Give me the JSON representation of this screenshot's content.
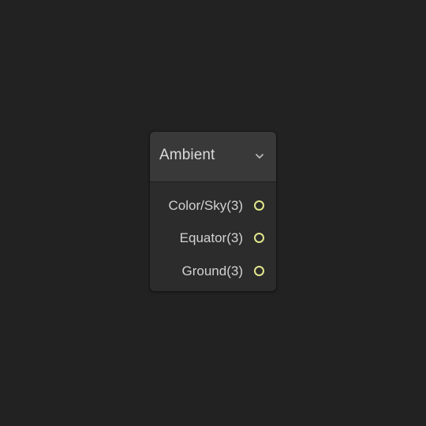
{
  "node": {
    "title": "Ambient",
    "collapse_icon": "chevron-down-icon",
    "ports": [
      {
        "label": "Color/Sky(3)",
        "type": "Vector3"
      },
      {
        "label": "Equator(3)",
        "type": "Vector3"
      },
      {
        "label": "Ground(3)",
        "type": "Vector3"
      }
    ]
  },
  "colors": {
    "canvas_bg": "#222222",
    "node_bg": "#2c2c2c",
    "header_bg": "#393939",
    "port_vector3": "#e2e68c"
  }
}
